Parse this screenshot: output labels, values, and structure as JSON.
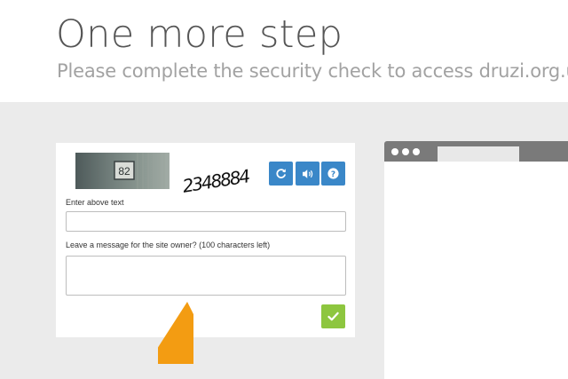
{
  "header": {
    "title": "One more step",
    "subtitle": "Please complete the security check to access druzi.org.ua"
  },
  "captcha": {
    "challenge_text": "2348884",
    "photo_number": "82",
    "refresh_icon": "refresh-icon",
    "audio_icon": "speaker-icon",
    "help_icon": "help-icon",
    "input_label": "Enter above text",
    "input_value": "",
    "message_label": "Leave a message for the site owner? (100 characters left)",
    "message_value": "",
    "submit_icon": "checkmark-icon"
  },
  "colors": {
    "button_blue": "#3a87c8",
    "submit_green": "#8dc63f",
    "warning_orange": "#f39c12",
    "background": "#ebebeb"
  }
}
